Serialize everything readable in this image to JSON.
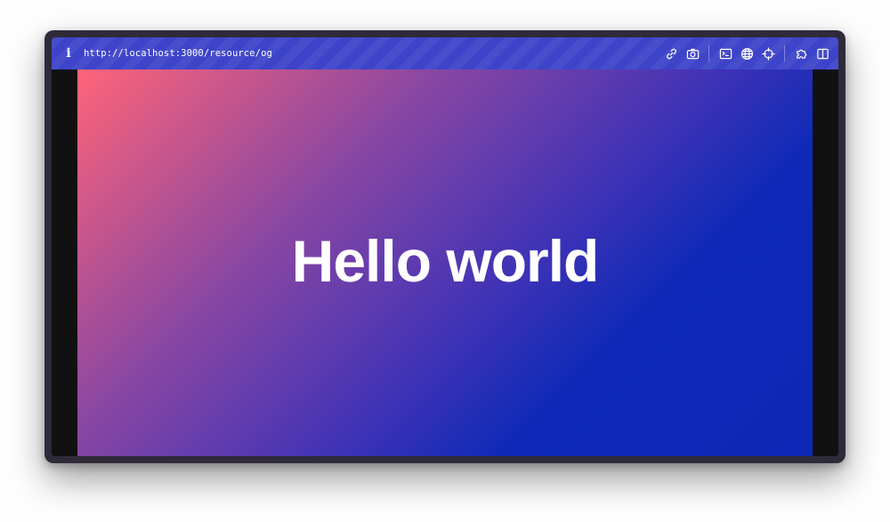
{
  "toolbar": {
    "info_label": "i",
    "url": "http://localhost:3000/resource/og",
    "icons": [
      "link-icon",
      "camera-icon",
      "terminal-icon",
      "globe-icon",
      "crosshair-icon",
      "puzzle-icon",
      "split-view-icon"
    ],
    "background_color": "#3d44c9"
  },
  "preview": {
    "title": "Hello world",
    "gradient_start": "#ff6478",
    "gradient_end": "#0d27b6"
  }
}
